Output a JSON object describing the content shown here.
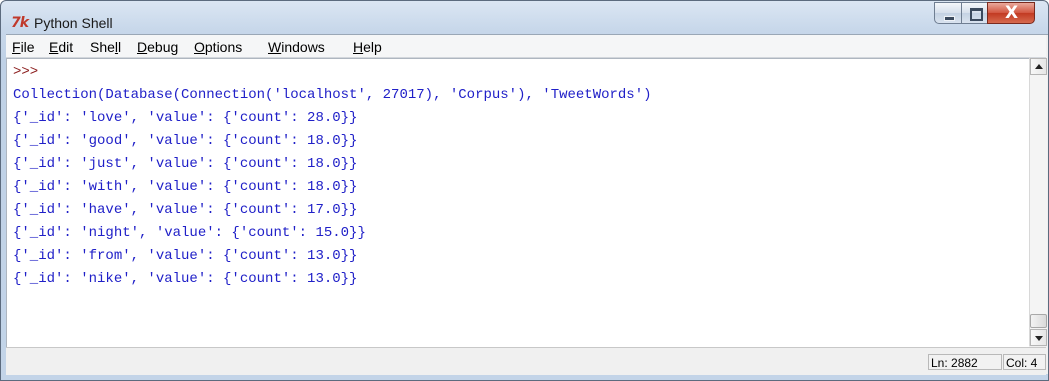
{
  "window": {
    "title": "Python Shell",
    "icon": "tk-feather-icon",
    "controls": [
      "minimize-icon",
      "maximize-icon",
      "close-icon"
    ],
    "close_glyph": "X"
  },
  "menu": {
    "items": [
      {
        "pre": "",
        "acc": "F",
        "post": "ile"
      },
      {
        "pre": "",
        "acc": "E",
        "post": "dit"
      },
      {
        "pre": "She",
        "acc": "l",
        "post": "l"
      },
      {
        "pre": "",
        "acc": "D",
        "post": "ebug"
      },
      {
        "pre": "",
        "acc": "O",
        "post": "ptions"
      },
      {
        "pre": "",
        "acc": "W",
        "post": "indows"
      },
      {
        "pre": "",
        "acc": "H",
        "post": "elp"
      }
    ]
  },
  "shell": {
    "prompt": ">>>",
    "lines": [
      "Collection(Database(Connection('localhost', 27017), 'Corpus'), 'TweetWords')",
      "{'_id': 'love', 'value': {'count': 28.0}}",
      "{'_id': 'good', 'value': {'count': 18.0}}",
      "{'_id': 'just', 'value': {'count': 18.0}}",
      "{'_id': 'with', 'value': {'count': 18.0}}",
      "{'_id': 'have', 'value': {'count': 17.0}}",
      "{'_id': 'night', 'value': {'count': 15.0}}",
      "{'_id': 'from', 'value': {'count': 13.0}}",
      "{'_id': 'nike', 'value': {'count': 13.0}}"
    ],
    "colors": {
      "output": "#2020c8",
      "prompt": "#8b1c1c"
    }
  },
  "status": {
    "ln": "Ln: 2882",
    "col": "Col: 4"
  }
}
